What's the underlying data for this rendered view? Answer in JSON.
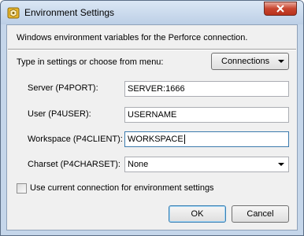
{
  "window": {
    "title": "Environment Settings",
    "icon": "perforce-app-icon"
  },
  "description": "Windows environment variables for the Perforce connection.",
  "prompt": "Type in settings or choose from menu:",
  "connections_button": "Connections",
  "fields": {
    "server": {
      "label": "Server (P4PORT):",
      "value": "SERVER:1666"
    },
    "user": {
      "label": "User (P4USER):",
      "value": "USERNAME"
    },
    "workspace": {
      "label": "Workspace (P4CLIENT):",
      "value": "WORKSPACE"
    },
    "charset": {
      "label": "Charset (P4CHARSET):",
      "value": "None"
    }
  },
  "use_current": {
    "label": "Use current connection for environment settings",
    "checked": false
  },
  "buttons": {
    "ok": "OK",
    "cancel": "Cancel"
  },
  "colors": {
    "accent": "#3c7fb1",
    "close": "#c8452f"
  }
}
